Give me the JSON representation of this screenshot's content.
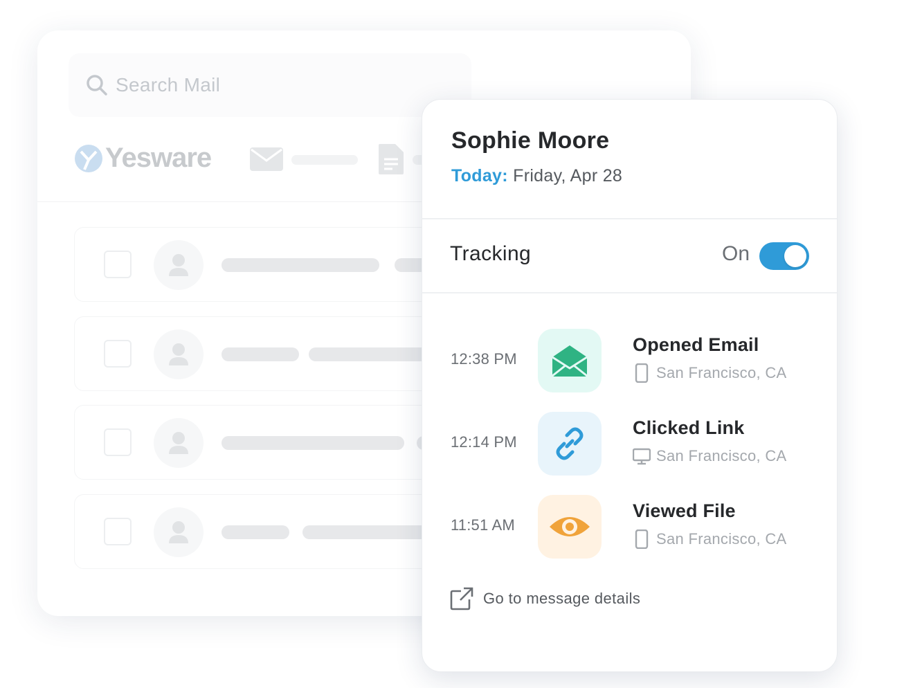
{
  "search": {
    "placeholder": "Search Mail",
    "icon": "search-icon"
  },
  "brand": {
    "name": "Yesware"
  },
  "contact": {
    "name": "Sophie Moore",
    "date_label": "Today:",
    "date_value": " Friday, Apr 28"
  },
  "tracking": {
    "label": "Tracking",
    "state_label": "On",
    "enabled": true
  },
  "events": [
    {
      "time": "12:38 PM",
      "title": "Opened Email",
      "location": "San Francisco, CA",
      "device": "mobile-icon",
      "icon": "open-envelope-icon",
      "color": "#2fb383",
      "bg": "#e3f9f4"
    },
    {
      "time": "12:14 PM",
      "title": "Clicked Link",
      "location": "San Francisco, CA",
      "device": "desktop-icon",
      "icon": "link-icon",
      "color": "#2f9bd8",
      "bg": "#e8f4fb"
    },
    {
      "time": "11:51 AM",
      "title": "Viewed File",
      "location": "San Francisco, CA",
      "device": "mobile-icon",
      "icon": "eye-icon",
      "color": "#f0a33a",
      "bg": "#fff2e2"
    }
  ],
  "details_link": {
    "label": "Go to message details"
  },
  "colors": {
    "accent": "#2f9bd8",
    "text": "#26282b",
    "muted": "#a4a8ad"
  }
}
